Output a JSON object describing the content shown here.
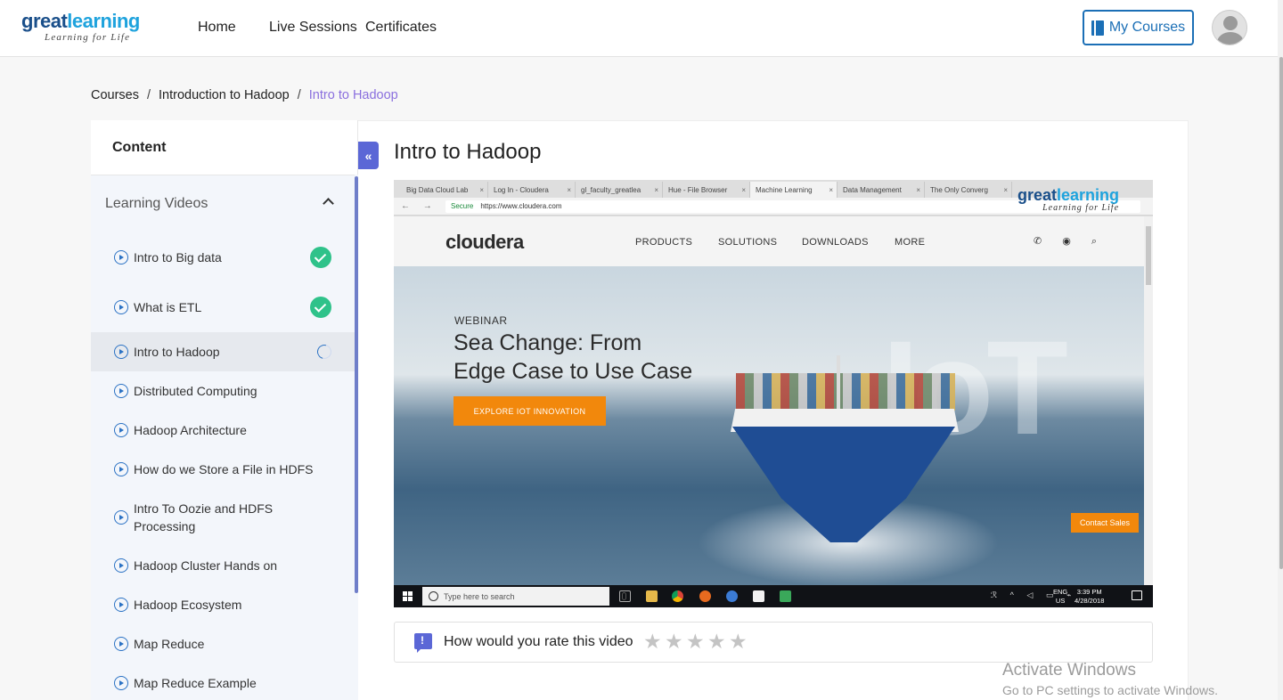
{
  "header": {
    "logo_word_1": "great",
    "logo_word_2": "learning",
    "logo_tagline": "Learning for Life",
    "nav": [
      "Home",
      "Live Sessions",
      "Certificates"
    ],
    "my_courses_label": "My Courses"
  },
  "breadcrumb": [
    "Courses",
    "Introduction to Hadoop",
    "Intro to Hadoop"
  ],
  "breadcrumb_sep": "/",
  "sidebar": {
    "title": "Content",
    "section": "Learning Videos",
    "collapse_glyph": "«",
    "items": [
      {
        "label": "Intro to Big data",
        "status": "completed"
      },
      {
        "label": "What is ETL",
        "status": "completed"
      },
      {
        "label": "Intro to Hadoop",
        "status": "in-progress"
      },
      {
        "label": "Distributed Computing",
        "status": "none"
      },
      {
        "label": "Hadoop Architecture",
        "status": "none"
      },
      {
        "label": "How do we Store a File in HDFS",
        "status": "none"
      },
      {
        "label": "Intro To Oozie and HDFS Processing",
        "status": "none"
      },
      {
        "label": "Hadoop Cluster Hands on",
        "status": "none"
      },
      {
        "label": "Hadoop Ecosystem",
        "status": "none"
      },
      {
        "label": "Map Reduce",
        "status": "none"
      },
      {
        "label": "Map Reduce Example",
        "status": "none"
      }
    ]
  },
  "video": {
    "title": "Intro to Hadoop",
    "browser_tabs": [
      "Big Data Cloud Lab",
      "Log In - Cloudera",
      "gl_faculty_greatlea",
      "Hue - File Browser",
      "Machine Learning",
      "Data Management",
      "The Only Converg"
    ],
    "tab_close": "×",
    "nav_glyphs": "← → C",
    "secure_label": "Secure",
    "url": "https://www.cloudera.com",
    "overlay_logo_1": "great",
    "overlay_logo_2": "learning",
    "overlay_tagline": "Learning for Life",
    "site_logo": "cloudera",
    "site_menu": [
      "PRODUCTS",
      "SOLUTIONS",
      "DOWNLOADS",
      "MORE"
    ],
    "site_icons": "✆ ◉ ⌕",
    "hero_eyebrow": "WEBINAR",
    "hero_heading_line1": "Sea Change: From",
    "hero_heading_line2": "Edge Case to Use Case",
    "hero_cta": "EXPLORE IOT INNOVATION",
    "hero_watermark": "IoT",
    "contact_sales": "Contact Sales",
    "taskbar_search": "Type here to search",
    "taskbar_tray": "ℛ ^ ◁ ▭ ⌁",
    "taskbar_lang_1": "ENG",
    "taskbar_lang_2": "US",
    "taskbar_time": "3:39 PM",
    "taskbar_date": "4/28/2018"
  },
  "rating": {
    "question": "How would you rate this video",
    "star_glyph": "★",
    "max_stars": 5,
    "current": 0
  },
  "watermark": {
    "line1": "Activate Windows",
    "line2": "Go to PC settings to activate Windows."
  }
}
